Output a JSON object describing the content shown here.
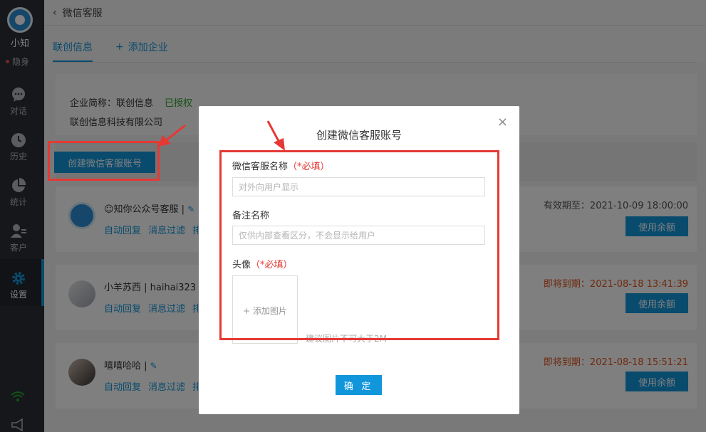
{
  "sidebar": {
    "user_name": "小知",
    "status": "隐身",
    "items": [
      {
        "label": "对话",
        "icon": "chat-icon"
      },
      {
        "label": "历史",
        "icon": "clock-icon"
      },
      {
        "label": "统计",
        "icon": "pie-chart-icon"
      },
      {
        "label": "客户",
        "icon": "customer-icon"
      },
      {
        "label": "设置",
        "icon": "gear-icon"
      }
    ],
    "active_item": "设置"
  },
  "header": {
    "back_label": "微信客服"
  },
  "tabs": [
    {
      "label": "联创信息",
      "active": true
    },
    {
      "label": "添加企业",
      "active": false
    }
  ],
  "company": {
    "short_name_label": "企业简称：联创信息",
    "auth_status": "已授权",
    "full_name": "联创信息科技有限公司"
  },
  "create_button_label": "创建微信客服账号",
  "accounts": [
    {
      "name": "☺知你公众号客服 |",
      "links": [
        "自动回复",
        "消息过滤",
        "排"
      ],
      "expiry": "有效期至：2021-10-09 18:00:00",
      "expiry_state": "ok",
      "button": "使用余额"
    },
    {
      "name": "小羊苏西 | haihai323",
      "links": [
        "自动回复",
        "消息过滤",
        "排"
      ],
      "expiry": "即将到期：2021-08-18 13:41:39",
      "expiry_state": "warn",
      "button": "使用余额"
    },
    {
      "name": "嘻嘻哈哈 |",
      "links": [
        "自动回复",
        "消息过滤",
        "排"
      ],
      "expiry": "即将到期：2021-08-18 15:51:21",
      "expiry_state": "warn",
      "button": "使用余额"
    }
  ],
  "modal": {
    "title": "创建微信客服账号",
    "close_symbol": "×",
    "name_label": "微信客服名称",
    "name_required": "（*必填）",
    "name_placeholder": "对外向用户显示",
    "remark_label": "备注名称",
    "remark_placeholder": "仅供内部查看区分，不会显示给用户",
    "avatar_label": "头像",
    "avatar_required": "（*必填）",
    "upload_label": "+ 添加图片",
    "upload_hint": "建议图片不可大于2M",
    "confirm_label": "确 定"
  },
  "colors": {
    "accent": "#1296db",
    "annotation_red": "#e53935",
    "warning": "#e0541f",
    "authorized": "#2aa52a"
  }
}
